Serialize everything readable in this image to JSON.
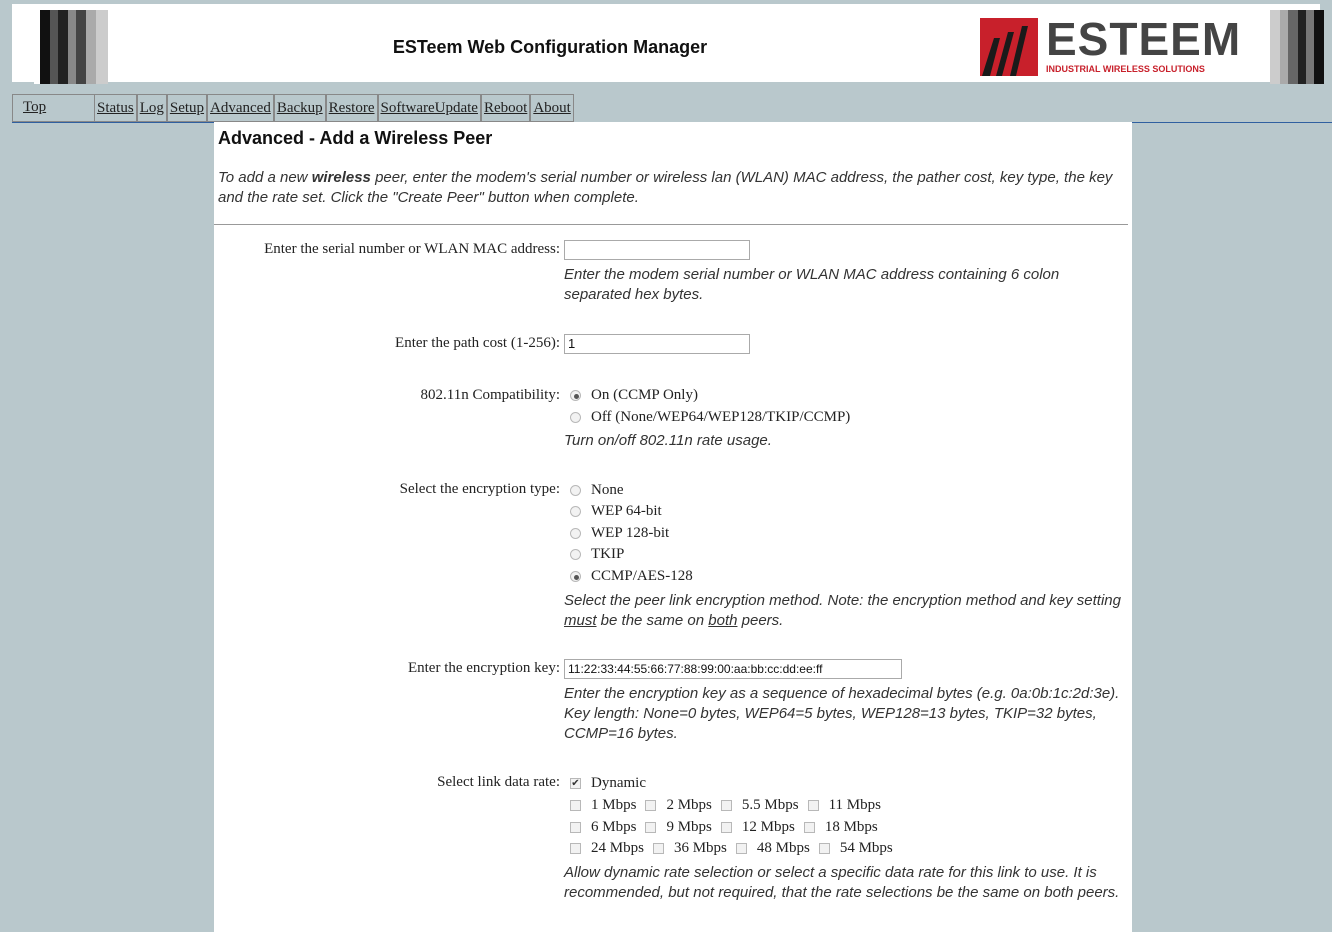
{
  "app": {
    "title": "ESTeem Web Configuration Manager"
  },
  "logo": {
    "word": "ESTEEM",
    "tagline": "INDUSTRIAL WIRELESS SOLUTIONS"
  },
  "nav": {
    "top": "Top",
    "tabs": [
      "Status",
      "Log",
      "Setup",
      "Advanced",
      "Backup",
      "Restore",
      "SoftwareUpdate",
      "Reboot",
      "About"
    ]
  },
  "page": {
    "title": "Advanced - Add a Wireless Peer",
    "intro_pre": "To add a new ",
    "intro_bold": "wireless",
    "intro_post": " peer, enter the modem's serial number or wireless lan (WLAN) MAC address, the pather cost, key type, the key and the rate set. Click the \"Create Peer\" button when complete."
  },
  "serial": {
    "label": "Enter the serial number or WLAN MAC address:",
    "value": "",
    "help": "Enter the modem serial number or WLAN MAC address containing 6 colon separated hex bytes."
  },
  "path_cost": {
    "label": "Enter the path cost (1-256):",
    "value": "1"
  },
  "compat": {
    "label": "802.11n Compatibility:",
    "options": [
      "On (CCMP Only)",
      "Off (None/WEP64/WEP128/TKIP/CCMP)"
    ],
    "selected": "On (CCMP Only)",
    "help": "Turn on/off 802.11n rate usage."
  },
  "encryption": {
    "label": "Select the encryption type:",
    "options": [
      "None",
      "WEP 64-bit",
      "WEP 128-bit",
      "TKIP",
      "CCMP/AES-128"
    ],
    "selected": "CCMP/AES-128",
    "help_1": "Select the peer link encryption method. Note: the encryption method and key setting ",
    "help_must": "must",
    "help_2": " be the same on ",
    "help_both": "both",
    "help_3": " peers."
  },
  "key": {
    "label": "Enter the encryption key:",
    "value": "11:22:33:44:55:66:77:88:99:00:aa:bb:cc:dd:ee:ff",
    "help": "Enter the encryption key as a sequence of hexadecimal bytes (e.g. 0a:0b:1c:2d:3e). Key length: None=0 bytes, WEP64=5 bytes, WEP128=13 bytes, TKIP=32 bytes, CCMP=16 bytes."
  },
  "rate": {
    "label": "Select link data rate:",
    "dynamic": "Dynamic",
    "dynamic_checked": true,
    "rows": [
      [
        "1 Mbps",
        "2 Mbps",
        "5.5 Mbps",
        "11 Mbps"
      ],
      [
        "6 Mbps",
        "9 Mbps",
        "12 Mbps",
        "18 Mbps"
      ],
      [
        "24 Mbps",
        "36 Mbps",
        "48 Mbps",
        "54 Mbps"
      ]
    ],
    "help": "Allow dynamic rate selection or select a specific data rate for this link to use. It is recommended, but not required, that the rate selections be the same on both peers."
  }
}
